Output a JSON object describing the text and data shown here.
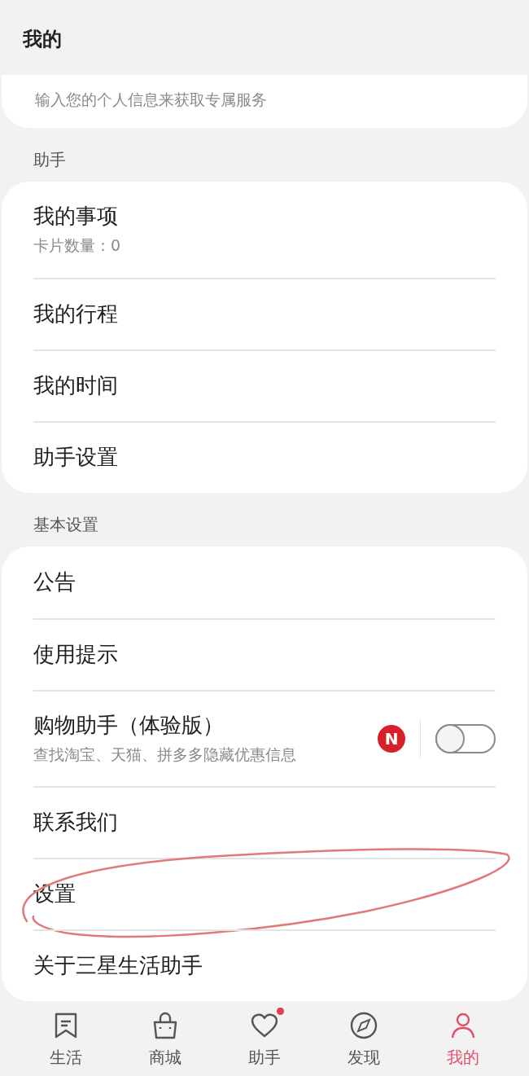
{
  "header": {
    "title": "我的"
  },
  "profile_card": {
    "subtitle": "输入您的个人信息来获取专属服务"
  },
  "sections": [
    {
      "label": "助手",
      "items": [
        {
          "kind": "plain",
          "title": "我的事项",
          "subtitle": "卡片数量：0",
          "circled": false
        },
        {
          "kind": "plain",
          "title": "我的行程",
          "circled": false
        },
        {
          "kind": "plain",
          "title": "我的时间",
          "circled": false
        },
        {
          "kind": "plain",
          "title": "助手设置",
          "circled": false
        }
      ]
    },
    {
      "label": "基本设置",
      "items": [
        {
          "kind": "plain",
          "title": "公告",
          "circled": false
        },
        {
          "kind": "plain",
          "title": "使用提示",
          "circled": false
        },
        {
          "kind": "toggle",
          "title": "购物助手（体验版）",
          "subtitle": "查找淘宝、天猫、拼多多隐藏优惠信息",
          "badge": "N",
          "on": false,
          "circled": false
        },
        {
          "kind": "plain",
          "title": "联系我们",
          "circled": false
        },
        {
          "kind": "plain",
          "title": "设置",
          "circled": true
        },
        {
          "kind": "plain",
          "title": "关于三星生活助手",
          "circled": false
        }
      ]
    }
  ],
  "bottom_nav": [
    {
      "kind": "bookmark",
      "label": "生活",
      "selected": false,
      "dot": false
    },
    {
      "kind": "bag",
      "label": "商城",
      "selected": false,
      "dot": false
    },
    {
      "kind": "heart",
      "label": "助手",
      "selected": false,
      "dot": true
    },
    {
      "kind": "compass",
      "label": "发现",
      "selected": false,
      "dot": false
    },
    {
      "kind": "person",
      "label": "我的",
      "selected": true,
      "dot": false
    }
  ]
}
